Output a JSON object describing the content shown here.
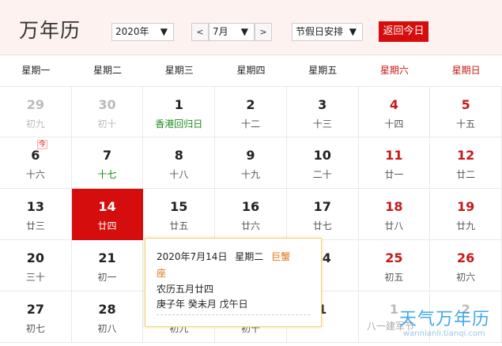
{
  "header": {
    "title": "万年历",
    "year_select": "2020年",
    "prev_label": "<",
    "month_select": "7月",
    "next_label": ">",
    "holiday_select": "节假日安排",
    "today_button": "返回今日",
    "arrow": "▼"
  },
  "weekdays": [
    "星期一",
    "星期二",
    "星期三",
    "星期四",
    "星期五",
    "星期六",
    "星期日"
  ],
  "today_mark": "今",
  "rows": [
    [
      {
        "day": "29",
        "lunar": "初九",
        "other": true
      },
      {
        "day": "30",
        "lunar": "初十",
        "other": true
      },
      {
        "day": "1",
        "lunar": "香港回归日",
        "festival": true
      },
      {
        "day": "2",
        "lunar": "十二"
      },
      {
        "day": "3",
        "lunar": "十三"
      },
      {
        "day": "4",
        "lunar": "十四",
        "weekend": true
      },
      {
        "day": "5",
        "lunar": "十五",
        "weekend": true
      }
    ],
    [
      {
        "day": "6",
        "lunar": "十六"
      },
      {
        "day": "7",
        "lunar": "十七",
        "green": true,
        "today": true
      },
      {
        "day": "8",
        "lunar": "十八"
      },
      {
        "day": "9",
        "lunar": "十九"
      },
      {
        "day": "10",
        "lunar": "二十"
      },
      {
        "day": "11",
        "lunar": "廿一",
        "weekend": true
      },
      {
        "day": "12",
        "lunar": "廿二",
        "weekend": true
      }
    ],
    [
      {
        "day": "13",
        "lunar": "廿三"
      },
      {
        "day": "14",
        "lunar": "廿四",
        "selected": true
      },
      {
        "day": "15",
        "lunar": "廿五"
      },
      {
        "day": "16",
        "lunar": "廿六"
      },
      {
        "day": "17",
        "lunar": "廿七"
      },
      {
        "day": "18",
        "lunar": "廿八",
        "weekend": true
      },
      {
        "day": "19",
        "lunar": "廿九",
        "weekend": true
      }
    ],
    [
      {
        "day": "20",
        "lunar": "三十"
      },
      {
        "day": "21",
        "lunar": "初一"
      },
      {
        "day": "",
        "lunar": ""
      },
      {
        "day": "",
        "lunar": ""
      },
      {
        "day": "24",
        "lunar": ""
      },
      {
        "day": "25",
        "lunar": "初五",
        "weekend": true
      },
      {
        "day": "26",
        "lunar": "初六",
        "weekend": true
      }
    ],
    [
      {
        "day": "27",
        "lunar": "初七"
      },
      {
        "day": "28",
        "lunar": "初八"
      },
      {
        "day": "",
        "lunar": "初九"
      },
      {
        "day": "",
        "lunar": "初十"
      },
      {
        "day": "1",
        "lunar": ""
      },
      {
        "day": "1",
        "lunar": "",
        "other": true
      },
      {
        "day": "2",
        "lunar": "",
        "other": true
      }
    ]
  ],
  "popup": {
    "date": "2020年7月14日",
    "weekday": "星期二",
    "zodiac_part1": "巨蟹",
    "zodiac_part2": "座",
    "lunar": "农历五月廿四",
    "ganzhi": "庚子年 癸未月 戊午日"
  },
  "extra_text": "八一建军节",
  "watermark": {
    "main": "天气万年历",
    "sub": "wannianli.tianqi.com"
  },
  "colors": {
    "accent": "#d50d0d",
    "weekend": "#c81818",
    "festival": "#1a8a1a",
    "zodiac": "#e0720f",
    "header_bg": "#fdf2ef"
  }
}
